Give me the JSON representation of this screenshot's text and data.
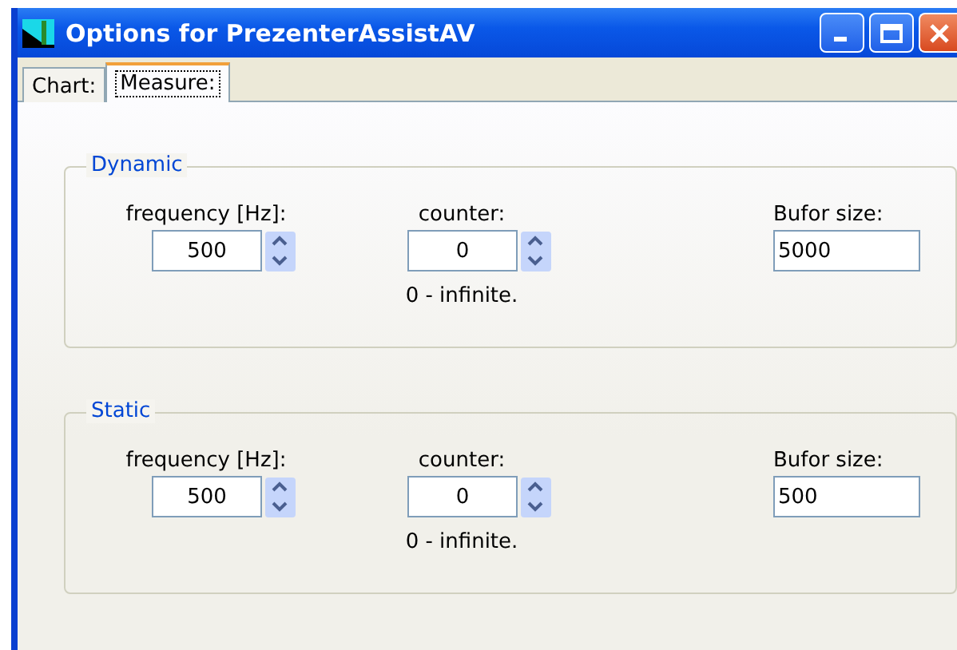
{
  "window": {
    "title": "Options for PrezenterAssistAV"
  },
  "tabs": [
    {
      "label": "Chart:",
      "selected": false
    },
    {
      "label": "Measure:",
      "selected": true
    }
  ],
  "groups": [
    {
      "title": "Dynamic",
      "fields": [
        {
          "kind": "spin",
          "label": "frequency [Hz]:",
          "value": "500"
        },
        {
          "kind": "spin",
          "label": "counter:",
          "value": "0",
          "note": "0 - infinite."
        },
        {
          "kind": "text",
          "label": "Bufor size:",
          "value": "5000"
        }
      ]
    },
    {
      "title": "Static",
      "fields": [
        {
          "kind": "spin",
          "label": "frequency [Hz]:",
          "value": "500"
        },
        {
          "kind": "spin",
          "label": "counter:",
          "value": "0",
          "note": "0 - infinite."
        },
        {
          "kind": "text",
          "label": "Bufor size:",
          "value": "500"
        }
      ]
    }
  ]
}
